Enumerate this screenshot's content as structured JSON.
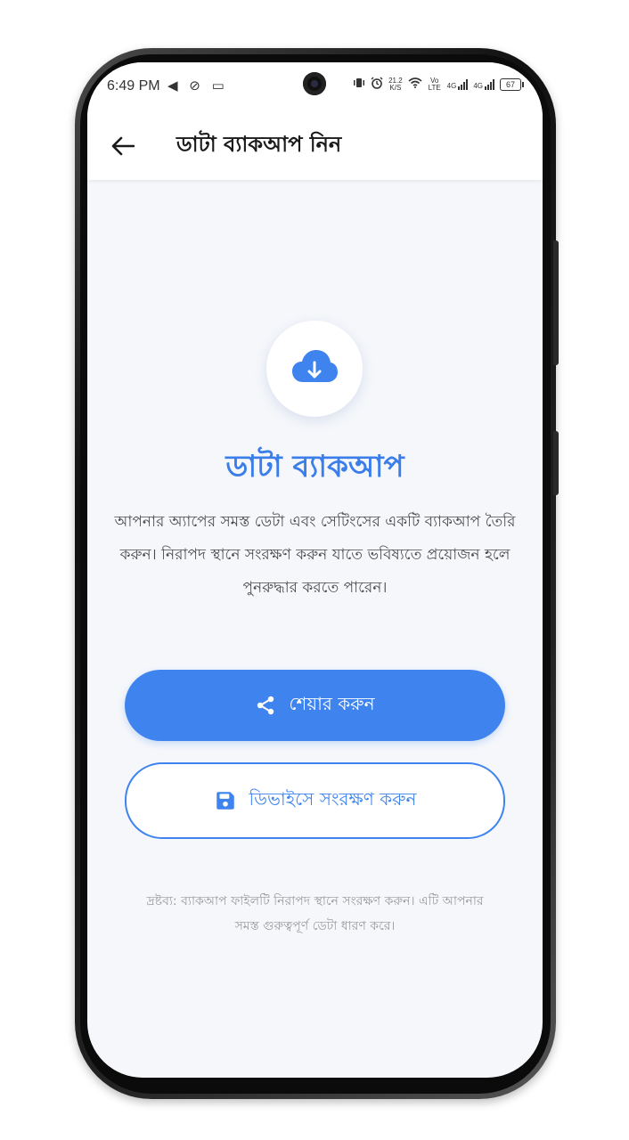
{
  "status_bar": {
    "time": "6:49 PM",
    "left_icons": "◀ ⊘ ▭",
    "net_speed_value": "21.2",
    "net_speed_unit": "K/S",
    "vo_lte": "Vo LTE",
    "net_type_1": "4G",
    "net_type_2": "4G",
    "battery": "67"
  },
  "app_bar": {
    "title": "ডাটা ব্যাকআপ নিন"
  },
  "content": {
    "hero_title": "ডাটা ব্যাকআপ",
    "description": "আপনার অ্যাপের সমস্ত ডেটা এবং সেটিংসের একটি ব্যাকআপ তৈরি করুন। নিরাপদ স্থানে সংরক্ষণ করুন যাতে ভবিষ্যতে প্রয়োজন হলে পুনরুদ্ধার করতে পারেন।",
    "share_button_label": "শেয়ার করুন",
    "save_button_label": "ডিভাইসে সংরক্ষণ করুন",
    "note": "দ্রষ্টব্য: ব্যাকআপ ফাইলটি নিরাপদ স্থানে সংরক্ষণ করুন। এটি আপনার সমস্ত গুরুত্বপূর্ণ ডেটা ধারণ করে।"
  },
  "icons": {
    "back": "arrow-left-icon",
    "hero": "cloud-download-icon",
    "share": "share-icon",
    "save": "save-icon"
  },
  "colors": {
    "accent": "#3f84ee",
    "title_blue": "#3b7de9",
    "background": "#f5f7fb"
  }
}
